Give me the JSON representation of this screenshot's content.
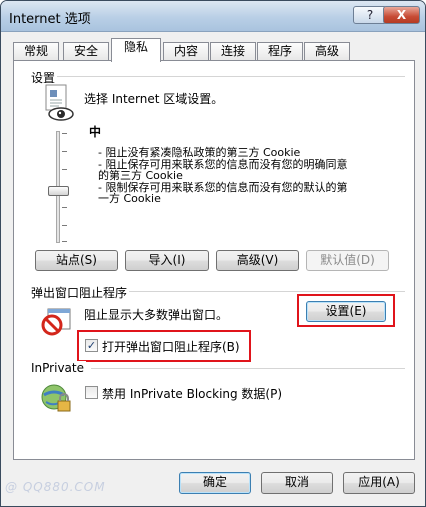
{
  "window": {
    "title": "Internet 选项",
    "help_label": "?",
    "close_label": "X"
  },
  "tabs": [
    {
      "label": "常规"
    },
    {
      "label": "安全"
    },
    {
      "label": "隐私"
    },
    {
      "label": "内容"
    },
    {
      "label": "连接"
    },
    {
      "label": "程序"
    },
    {
      "label": "高级"
    }
  ],
  "settings": {
    "heading": "设置",
    "zone_prompt": "选择 Internet 区域设置。",
    "level": "中",
    "desc_lines": [
      "- 阻止没有紧凑隐私政策的第三方 Cookie",
      "- 阻止保存可用来联系您的信息而没有您的明确同意",
      "的第三方 Cookie",
      "- 限制保存可用来联系您的信息而没有您的默认的第",
      "一方 Cookie"
    ],
    "buttons": {
      "sites": "站点(S)",
      "import": "导入(I)",
      "advanced": "高级(V)",
      "default": "默认值(D)"
    }
  },
  "popup": {
    "heading": "弹出窗口阻止程序",
    "description": "阻止显示大多数弹出窗口。",
    "settings_button": "设置(E)",
    "checkbox_label": "打开弹出窗口阻止程序(B)",
    "checkbox_checked": true
  },
  "inprivate": {
    "heading": "InPrivate",
    "checkbox_label": "禁用 InPrivate Blocking 数据(P)",
    "checkbox_checked": false
  },
  "footer": {
    "ok": "确定",
    "cancel": "取消",
    "apply": "应用(A)"
  },
  "watermark": "@ QQ880.COM",
  "colors": {
    "highlight": "#e0141b",
    "titlebar": "#b9cfe6"
  }
}
